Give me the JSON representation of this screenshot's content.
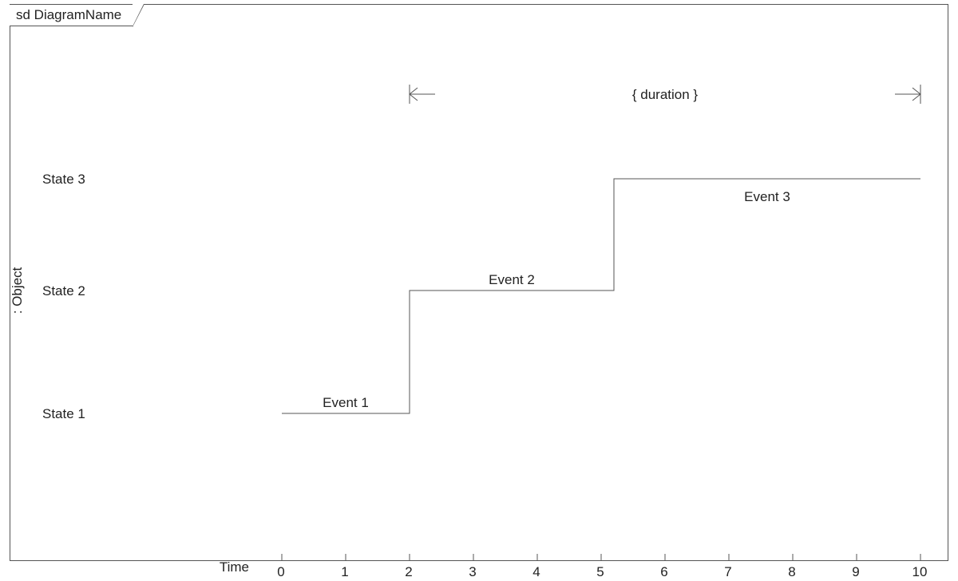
{
  "title": "sd DiagramName",
  "object_label": ": Object",
  "time_label": "Time",
  "duration_label": "{ duration }",
  "states": [
    "State 1",
    "State 2",
    "State 3"
  ],
  "events": [
    "Event 1",
    "Event 2",
    "Event 3"
  ],
  "ticks": [
    "0",
    "1",
    "2",
    "3",
    "4",
    "5",
    "6",
    "7",
    "8",
    "9",
    "10"
  ],
  "chart_data": {
    "type": "line",
    "title": "sd DiagramName",
    "xlabel": "Time",
    "ylabel": ": Object",
    "categories": [
      "State 1",
      "State 2",
      "State 3"
    ],
    "x_ticks": [
      0,
      1,
      2,
      3,
      4,
      5,
      6,
      7,
      8,
      9,
      10
    ],
    "timeline": [
      {
        "state": "State 1",
        "from": 0,
        "to": 2,
        "event": "Event 1"
      },
      {
        "state": "State 2",
        "from": 2,
        "to": 5.2,
        "event": "Event 2"
      },
      {
        "state": "State 3",
        "from": 5.2,
        "to": 10,
        "event": "Event 3"
      }
    ],
    "duration_constraint": {
      "from": 2,
      "to": 10,
      "label": "{ duration }"
    },
    "xlim": [
      0,
      10
    ]
  }
}
